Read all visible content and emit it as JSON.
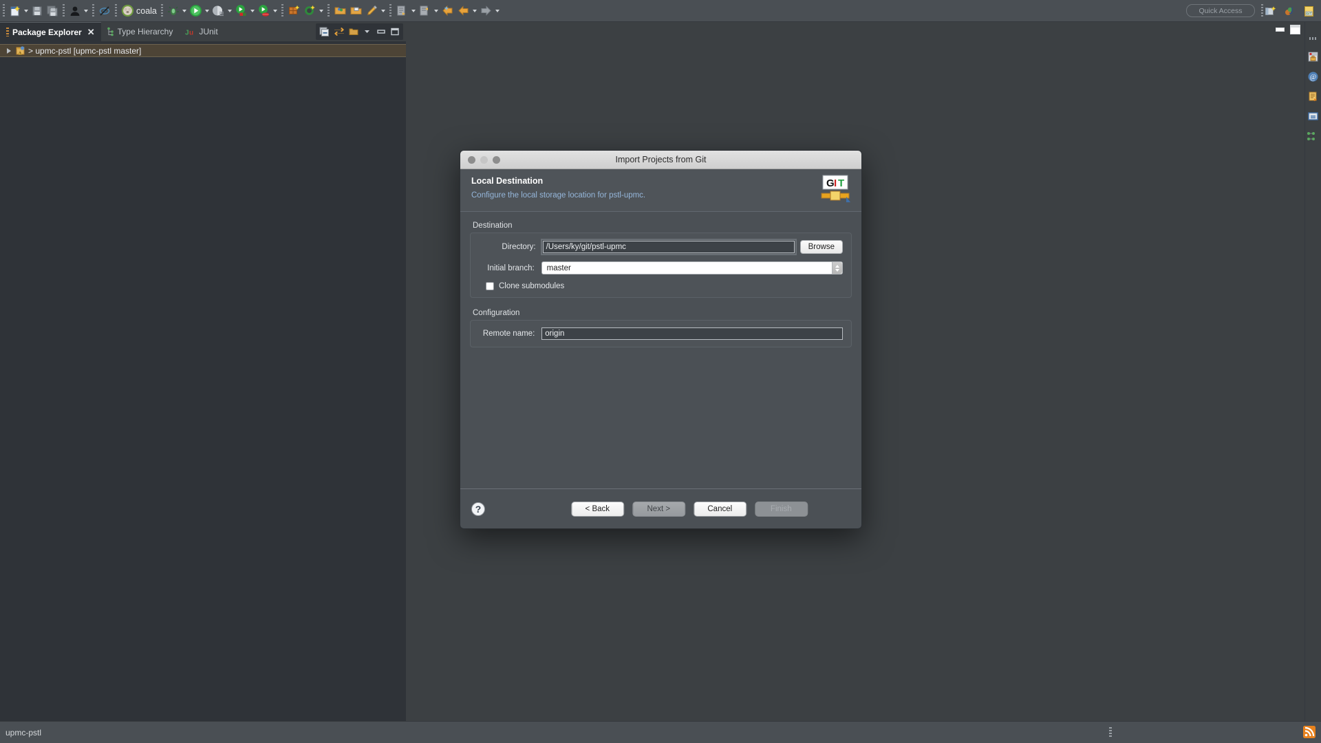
{
  "toolbar": {
    "groups": [
      {
        "items": [
          {
            "name": "new-file-icon",
            "arrow": true
          },
          {
            "name": "save-icon",
            "arrow": false
          },
          {
            "name": "save-all-icon",
            "arrow": false
          }
        ]
      },
      {
        "items": [
          {
            "name": "user-profile-icon",
            "arrow": true
          }
        ]
      },
      {
        "items": [
          {
            "name": "skip-breakpoints-icon",
            "arrow": false
          }
        ]
      },
      {
        "items": [
          {
            "name": "coala-icon",
            "arrow": false,
            "label": "coala"
          }
        ]
      },
      {
        "items": [
          {
            "name": "debug-icon",
            "arrow": true
          },
          {
            "name": "run-icon",
            "arrow": true
          },
          {
            "name": "profile-icon",
            "arrow": true
          },
          {
            "name": "run-external-tools-icon",
            "arrow": true
          },
          {
            "name": "coverage-icon",
            "arrow": true
          }
        ]
      },
      {
        "items": [
          {
            "name": "new-java-package-icon",
            "arrow": false
          },
          {
            "name": "new-java-project-icon",
            "arrow": true
          }
        ]
      },
      {
        "items": [
          {
            "name": "open-type-icon",
            "arrow": false
          },
          {
            "name": "open-task-icon",
            "arrow": false
          },
          {
            "name": "annotate-icon",
            "arrow": true
          }
        ]
      },
      {
        "items": [
          {
            "name": "next-annotation-icon",
            "arrow": true
          },
          {
            "name": "previous-annotation-icon",
            "arrow": true
          },
          {
            "name": "last-edit-location-icon",
            "arrow": false
          },
          {
            "name": "back-icon",
            "arrow": true
          },
          {
            "name": "forward-icon",
            "arrow": true
          }
        ]
      }
    ],
    "coala_label": "coala"
  },
  "quick_access": {
    "placeholder": "Quick Access",
    "value": ""
  },
  "perspectives": [
    {
      "name": "open-perspective-icon"
    },
    {
      "name": "java-perspective-icon"
    },
    {
      "name": "git-perspective-icon"
    }
  ],
  "left_view": {
    "tabs": [
      {
        "label": "Package Explorer",
        "active": true,
        "closable": true,
        "icon": "package-explorer-icon"
      },
      {
        "label": "Type Hierarchy",
        "active": false,
        "closable": false,
        "icon": "type-hierarchy-icon"
      },
      {
        "label": "JUnit",
        "active": false,
        "closable": false,
        "icon": "junit-icon"
      }
    ],
    "view_toolbar": [
      {
        "name": "collapse-all-icon"
      },
      {
        "name": "link-with-editor-icon"
      },
      {
        "name": "view-menu-folder-icon"
      },
      {
        "name": "view-menu-icon"
      },
      {
        "name": "minimize-view-icon"
      },
      {
        "name": "maximize-view-icon"
      }
    ],
    "tree_items": [
      {
        "label": "> upmc-pstl [upmc-pstl master]",
        "selected": true,
        "expandable": true,
        "icon": "java-project-warning-icon"
      }
    ]
  },
  "editor_controls": [
    {
      "name": "minimize-editor-icon"
    },
    {
      "name": "maximize-editor-icon"
    }
  ],
  "right_bar": {
    "items": [
      {
        "name": "servers-view-icon"
      },
      {
        "name": "javadoc-view-icon"
      },
      {
        "name": "declaration-view-icon"
      },
      {
        "name": "console-view-icon"
      },
      {
        "name": "call-hierarchy-view-icon"
      }
    ]
  },
  "status_bar": {
    "text": "upmc-pstl",
    "rss_icon": "rss-feed-icon"
  },
  "dialog": {
    "title": "Import Projects from Git",
    "traffic_lights": [
      {
        "name": "close-window-button"
      },
      {
        "name": "minimize-window-button"
      },
      {
        "name": "zoom-window-button"
      }
    ],
    "heading": "Local Destination",
    "subtitle": "Configure the local storage location for pstl-upmc.",
    "banner_icon": "git-logo-icon",
    "git_logo": {
      "g": "G",
      "i": "I",
      "t": "T"
    },
    "destination_group": {
      "label": "Destination",
      "directory_label": "Directory:",
      "directory_value": "/Users/ky/git/pstl-upmc",
      "browse_label": "Browse",
      "branch_label": "Initial branch:",
      "branch_value": "master",
      "branch_options": [
        "master"
      ],
      "submodules_label": "Clone submodules",
      "submodules_checked": false
    },
    "configuration_group": {
      "label": "Configuration",
      "remote_label": "Remote name:",
      "remote_value": "origin"
    },
    "footer": {
      "help_label": "?",
      "back_label": "< Back",
      "next_label": "Next >",
      "cancel_label": "Cancel",
      "finish_label": "Finish"
    }
  },
  "colors": {
    "window_bg": "#3c4043",
    "panel_bg": "#2f3338",
    "toolbar_bg": "#4a4f54",
    "dialog_bg": "#4b5055",
    "selection_bg": "#4d4436",
    "link_blue": "#95b6da",
    "accent_orange": "#e8821e"
  }
}
